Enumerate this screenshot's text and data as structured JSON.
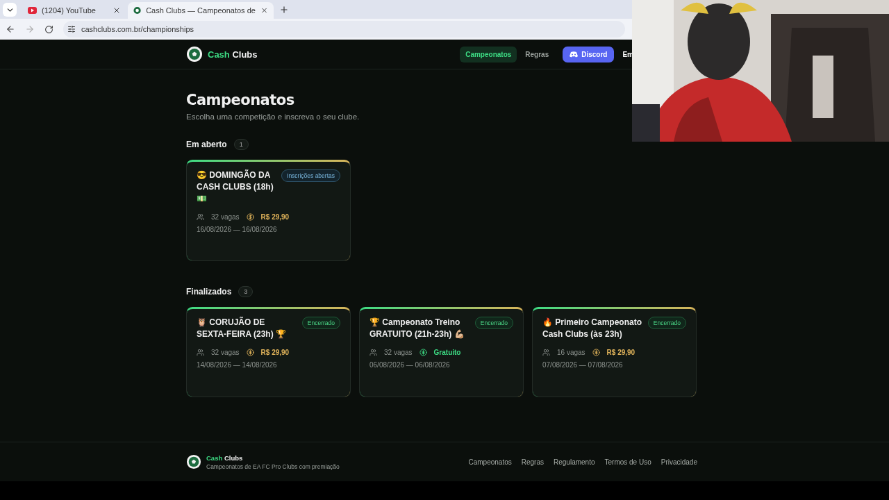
{
  "browser": {
    "tabs": [
      {
        "title": "(1204) YouTube",
        "selected": false,
        "kind": "youtube"
      },
      {
        "title": "Cash Clubs — Campeonatos de",
        "selected": true,
        "kind": "site"
      }
    ],
    "url": "cashclubs.com.br/championships"
  },
  "header": {
    "brand_a": "Cash",
    "brand_b": "Clubs",
    "nav": [
      {
        "label": "Campeonatos",
        "selected": true
      },
      {
        "label": "Regras",
        "selected": false
      }
    ],
    "discord": "Discord",
    "nav_more": "Em"
  },
  "page": {
    "title": "Campeonatos",
    "subtitle": "Escolha uma competição e inscreva o seu clube."
  },
  "sections": [
    {
      "title": "Em aberto",
      "count": "1",
      "cards": [
        {
          "title": "😎 DOMINGÃO DA CASH CLUBS (18h) 💵",
          "status": "Inscrições abertas",
          "registration_open": true,
          "slots": "32 vagas",
          "price": "R$ 29,90",
          "free": false,
          "dates": "16/08/2026 — 16/08/2026"
        }
      ]
    },
    {
      "title": "Finalizados",
      "count": "3",
      "cards": [
        {
          "title": "🦉 CORUJÃO DE SEXTA-FEIRA (23h) 🏆",
          "status": "Encerrado",
          "registration_open": false,
          "slots": "32 vagas",
          "price": "R$ 29,90",
          "free": false,
          "dates": "14/08/2026 — 14/08/2026"
        },
        {
          "title": "🏆 Campeonato Treino GRATUITO (21h-23h) 💪🏼",
          "status": "Encerrado",
          "registration_open": false,
          "slots": "32 vagas",
          "price": "Gratuito",
          "free": true,
          "dates": "06/08/2026 — 06/08/2026"
        },
        {
          "title": "🔥 Primeiro Campeonato Cash Clubs (às 23h)",
          "status": "Encerrado",
          "registration_open": false,
          "slots": "16 vagas",
          "price": "R$ 29,90",
          "free": false,
          "dates": "07/08/2026 — 07/08/2026"
        }
      ]
    }
  ],
  "footer": {
    "brand_a": "Cash",
    "brand_b": "Clubs",
    "tagline": "Campeonatos de EA FC Pro Clubs com premiação",
    "links": [
      "Campeonatos",
      "Regras",
      "Regulamento",
      "Termos de Uso",
      "Privacidade"
    ]
  }
}
